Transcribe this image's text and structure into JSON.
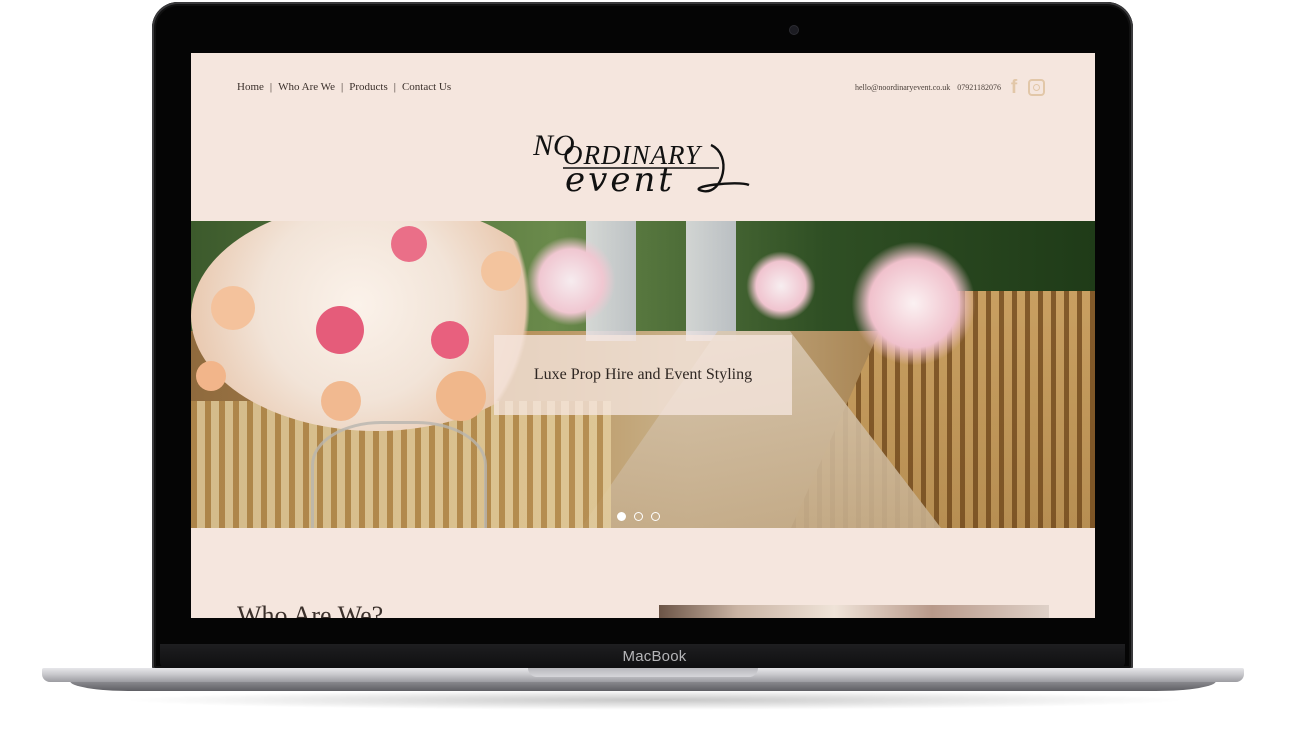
{
  "device": {
    "brand_label": "MacBook"
  },
  "site": {
    "nav": {
      "home": "Home",
      "who": "Who Are We",
      "products": "Products",
      "contact": "Contact Us",
      "separator": "|"
    },
    "contact": {
      "email": "hello@noordinaryevent.co.uk",
      "phone": "07921182076",
      "social_icons": [
        "facebook-icon",
        "instagram-icon"
      ],
      "icon_color": "#e2c7a8"
    },
    "logo": {
      "line1a": "NO",
      "line1b": "ORDINARY",
      "line2": "event"
    },
    "hero": {
      "caption": "Luxe Prop Hire and Event Styling",
      "slides_total": 3,
      "active_slide": 1
    },
    "section": {
      "title": "Who Are We?"
    },
    "colors": {
      "background": "#f5e6de",
      "text": "#3b302b"
    }
  }
}
